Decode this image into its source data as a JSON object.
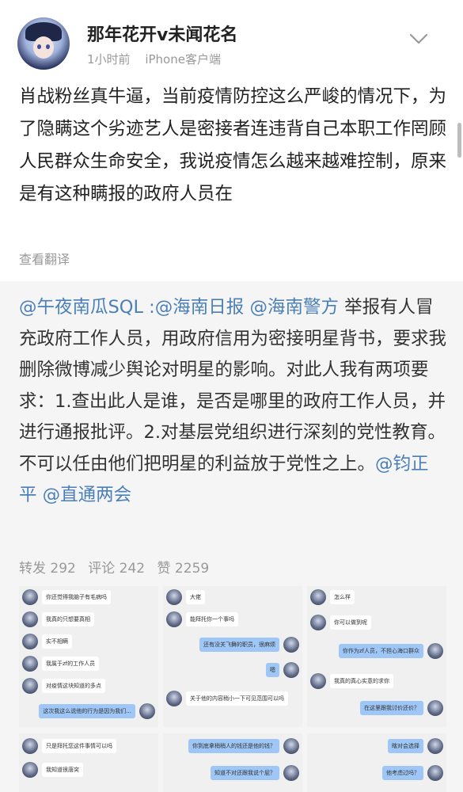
{
  "header": {
    "username": "那年花开v未闻花名",
    "time": "1小时前",
    "client": "iPhone客户端"
  },
  "post": {
    "text": "肖战粉丝真牛逼，当前疫情防控这么严峻的情况下，为了隐瞒这个劣迹艺人是密接者连违背自己本职工作罔顾人民群众生命安全，我说疫情怎么越来越难控制，原来是有这种瞒报的政府人员在",
    "translate_label": "查看翻译"
  },
  "quote": {
    "mention_author": "@午夜南瓜SQL",
    "colon": " :",
    "mention_1": "@海南日报",
    "mention_2": "@海南警方",
    "body": " 举报有人冒充政府工作人员，用政府信用为密接明星背书，要求我删除微博减少舆论对明星的影响。对此人我有两项要求：1.查出此人是谁，是否是哪里的政府工作人员，并进行通报批评。2.对基层党组织进行深刻的党性教育。不可以任由他们把明星的利益放于党性之上。",
    "mention_3": "@钧正平",
    "mention_4": "@直通两会",
    "stats": {
      "repost": "转发 292",
      "comment": "评论 242",
      "like": "赞 2259"
    }
  },
  "screenshots": {
    "s1": [
      "你还觉得我脑子有毛病吗",
      "我真的只想要真相",
      "实不相瞒",
      "我属于zf的工作人员",
      "对疫情这块知道的多点",
      "这次我这么说他的行为是因为我们...",
      "只是拜托您这件事情可以吗",
      "我知道很唐突"
    ],
    "s2": [
      "大佬",
      "能拜托你一个事吗",
      "还有没关飞舞的职员，很麻烦",
      "嗯",
      "关于他的内容稍小一下可见范围可以吗",
      "你到底拿稍稍人的钱还是他的钱？",
      "知道不对还跟我说个屁？"
    ],
    "s3": [
      "怎么样",
      "你可以做到呢",
      "你作为zf人员，不担心海口群众",
      "我真的真心实意的求你",
      "在这里跟我讨价还价？",
      "瞎对会选择",
      "他考虑过吗？"
    ]
  }
}
